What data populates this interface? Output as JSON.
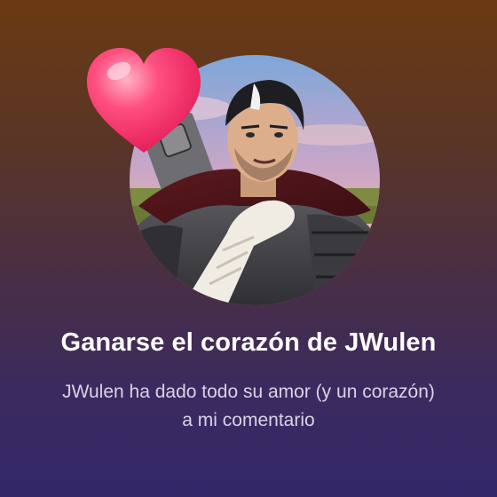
{
  "achievement": {
    "title": "Ganarse el corazón de JWulen",
    "description": "JWulen ha dado todo su amor (y un corazón) a mi comentario",
    "avatar_icon": "avatar",
    "badge_icon": "heart-icon"
  },
  "colors": {
    "background_top": "#6b3a12",
    "background_bottom": "#33276a",
    "title_text": "#ffffff",
    "description_text": "#d9d3e6",
    "heart": "#ff3d6e"
  }
}
